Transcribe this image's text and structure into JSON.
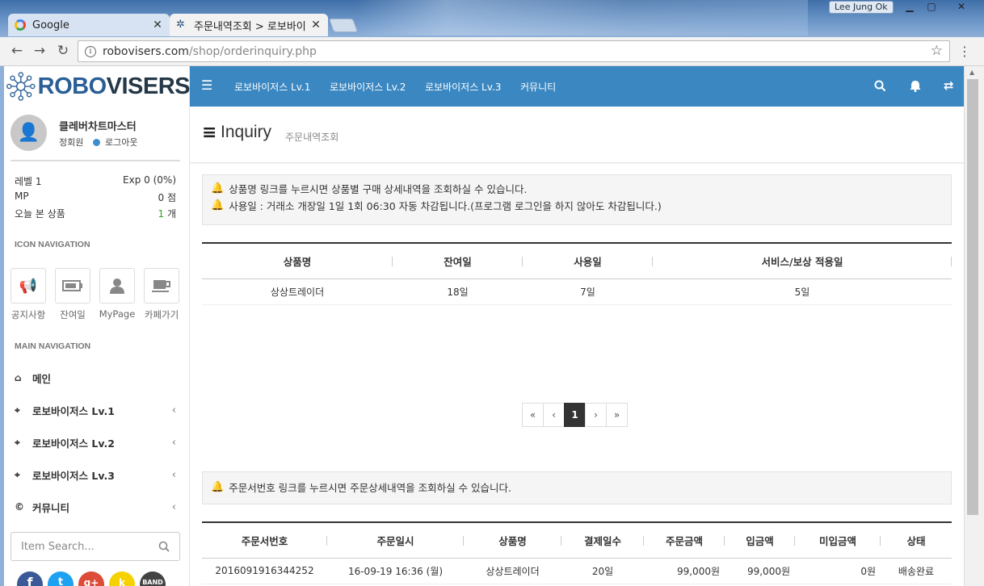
{
  "browser": {
    "tabs": [
      {
        "label": "Google",
        "close": "✕"
      },
      {
        "label": "주문내역조회 > 로보바이",
        "close": "✕"
      }
    ],
    "user_badge": "Lee Jung Ok",
    "url_host": "robovisers.com",
    "url_path": "/shop/orderinquiry.php"
  },
  "sidebar": {
    "logo_a": "ROBO",
    "logo_b": "VISERS",
    "user_name": "클레버차트마스터",
    "user_grade": "정회원",
    "logout": "로그아웃",
    "stats": [
      {
        "label": "레벨 1",
        "value": "Exp 0 (0%)"
      },
      {
        "label": "MP",
        "value": "0 점"
      },
      {
        "label": "오늘 본 상품",
        "value_num": "1",
        "value_unit": " 개"
      }
    ],
    "icon_nav_title": "ICON NAVIGATION",
    "icon_nav": [
      {
        "label": "공지사항",
        "icon": "megaphone-icon"
      },
      {
        "label": "잔여일",
        "icon": "battery-icon"
      },
      {
        "label": "MyPage",
        "icon": "user-icon"
      },
      {
        "label": "카페가기",
        "icon": "coffee-icon"
      }
    ],
    "main_nav_title": "MAIN NAVIGATION",
    "main_nav": [
      {
        "label": "메인",
        "icon": "home-icon"
      },
      {
        "label": "로보바이저스 Lv.1",
        "icon": "crosshair-icon"
      },
      {
        "label": "로보바이저스 Lv.2",
        "icon": "crosshair-icon"
      },
      {
        "label": "로보바이저스 Lv.3",
        "icon": "crosshair-icon"
      },
      {
        "label": "커뮤니티",
        "icon": "copyright-icon"
      }
    ],
    "search_placeholder": "Item Search..."
  },
  "topnav": {
    "items": [
      "로보바이저스 Lv.1",
      "로보바이저스 Lv.2",
      "로보바이저스 Lv.3",
      "커뮤니티"
    ]
  },
  "header": {
    "title": "Inquiry",
    "subtitle": "주문내역조회"
  },
  "notice1": [
    "상품명 링크를 누르시면 상품별 구매 상세내역을 조회하실 수 있습니다.",
    "사용일 : 거래소 개장일 1일 1회 06:30 자동 차감됩니다.(프로그램 로그인을 하지 않아도 차감됩니다.)"
  ],
  "table1": {
    "headers": [
      "상품명",
      "잔여일",
      "사용일",
      "서비스/보상 적용일"
    ],
    "rows": [
      [
        "상상트레이더",
        "18일",
        "7일",
        "5일"
      ]
    ]
  },
  "pager": [
    "«",
    "‹",
    "1",
    "›",
    "»"
  ],
  "notice2": [
    "주문서번호 링크를 누르시면 주문상세내역을 조회하실 수 있습니다."
  ],
  "table2": {
    "headers": [
      "주문서번호",
      "주문일시",
      "상품명",
      "결제일수",
      "주문금액",
      "입금액",
      "미입금액",
      "상태"
    ],
    "rows": [
      [
        "2016091916344252",
        "16-09-19 16:36 (월)",
        "상상트레이더",
        "20일",
        "99,000원",
        "99,000원",
        "0원",
        "배송완료"
      ]
    ]
  },
  "colors": {
    "topnav": "#3a87c1",
    "brand": "#2a5f96"
  }
}
